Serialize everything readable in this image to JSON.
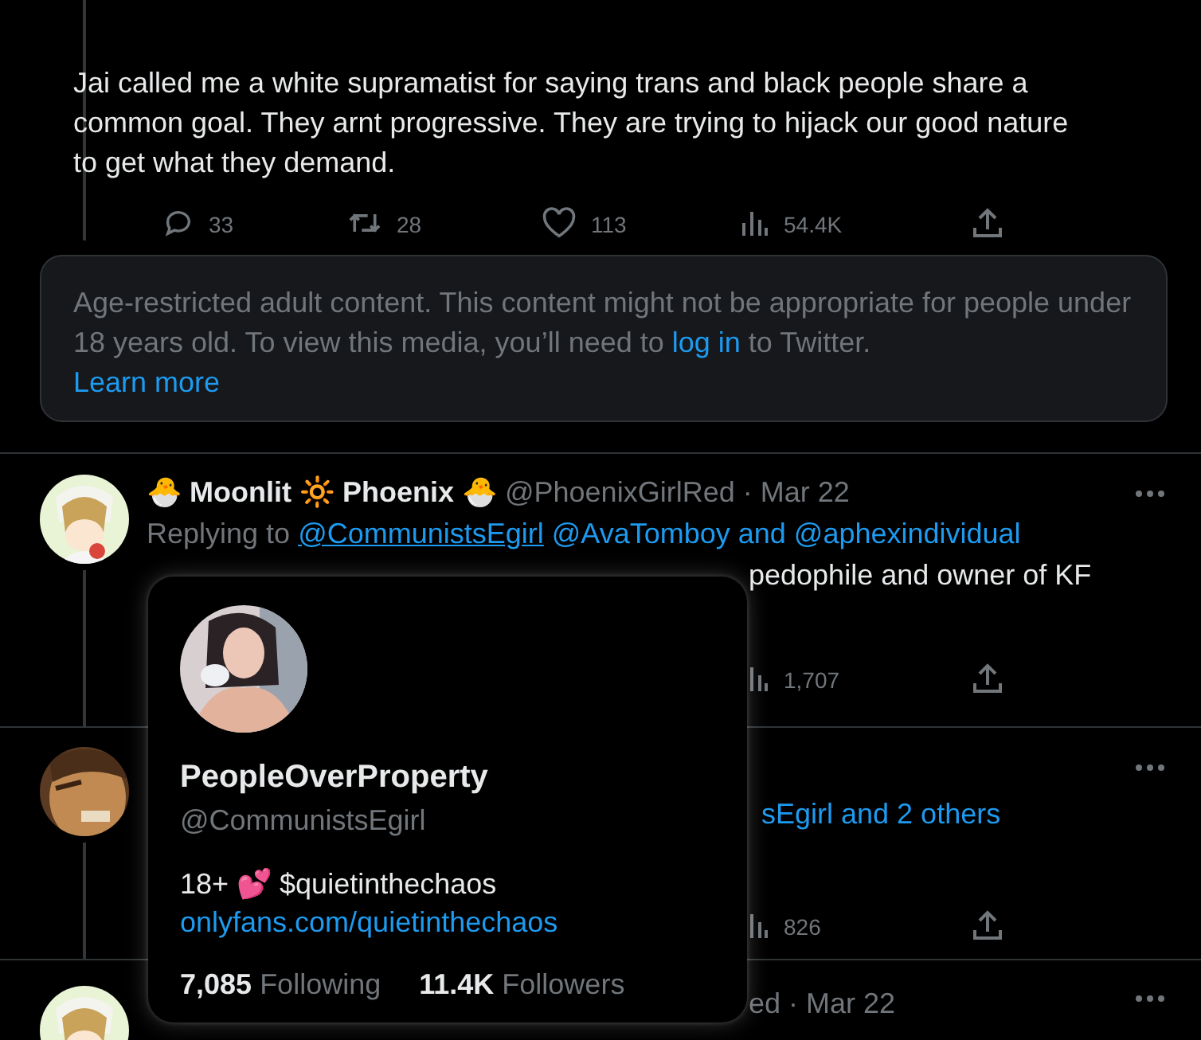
{
  "first_tweet": {
    "text": "Jai called me a white supramatist for saying trans and black people share a common goal.  They arnt progressive.  They are trying to hijack our good nature to get what they demand.",
    "actions": [
      {
        "kind": "reply",
        "count": "33"
      },
      {
        "kind": "retweet",
        "count": "28"
      },
      {
        "kind": "like",
        "count": "113"
      },
      {
        "kind": "views",
        "count": "54.4K"
      },
      {
        "kind": "share"
      }
    ]
  },
  "age_notice": {
    "text_before": "Age-restricted adult content. This content might not be appropriate for people under 18 years old. To view this media, you’ll need to",
    "login_link": "log in",
    "text_after": "to Twitter.",
    "learn_more": "Learn more"
  },
  "second_tweet": {
    "name": "🐣 Moonlit 🔆 Phoenix 🐣",
    "handle": "@PhoenixGirlRed",
    "separator": "·",
    "date": "Mar 22",
    "replying_label": "Replying to",
    "mentions": [
      {
        "text": "@CommunistsEgirl",
        "hovered": true
      },
      {
        "text": "@AvaTomboy and @aphexindividual",
        "hovered": false
      }
    ],
    "text_visible": "pedophile and owner of KF",
    "actions": [
      {
        "kind": "views",
        "count": "1,707"
      },
      {
        "kind": "share"
      }
    ]
  },
  "third_tweet": {
    "replying_visible": "sEgirl and 2 others",
    "actions": [
      {
        "kind": "views",
        "count": "826"
      },
      {
        "kind": "share"
      }
    ]
  },
  "fourth_tweet": {
    "name_visible": "ed",
    "separator": "·",
    "date": "Mar 22"
  },
  "profile_card": {
    "name": "PeopleOverProperty",
    "handle": "@CommunistsEgirl",
    "bio": "18+ 💕 $quietinthechaos",
    "link": "onlyfans.com/quietinthechaos",
    "following_count": "7,085",
    "following_label": "Following",
    "followers_count": "11.4K",
    "followers_label": "Followers"
  }
}
